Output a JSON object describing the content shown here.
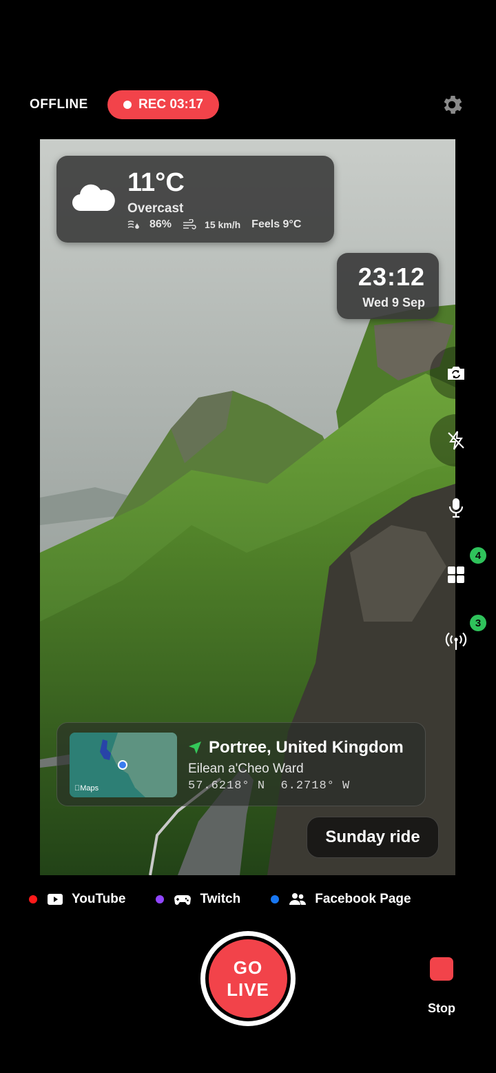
{
  "header": {
    "status": "OFFLINE",
    "recording_label": "REC 03:17",
    "settings_icon": "gear-icon"
  },
  "weather": {
    "temperature": "11°C",
    "condition": "Overcast",
    "humidity": "86%",
    "wind": "15 km/h",
    "feels_like": "Feels 9°C",
    "icon": "cloud-icon"
  },
  "clock": {
    "time": "23:12",
    "date": "Wed 9 Sep"
  },
  "location": {
    "place": "Portree, United Kingdom",
    "ward": "Eilean a'Cheo Ward",
    "latitude": "57.6218° N",
    "longitude": "6.2718° W",
    "map_label": "Maps"
  },
  "caption": "Sunday ride",
  "controls": {
    "overlays_badge": "4",
    "destinations_badge": "3"
  },
  "platforms": [
    {
      "name": "YouTube",
      "dot_color": "#ff1a1a",
      "icon": "youtube-icon"
    },
    {
      "name": "Twitch",
      "dot_color": "#9146ff",
      "icon": "gamepad-icon"
    },
    {
      "name": "Facebook Page",
      "dot_color": "#1877f2",
      "icon": "people-icon"
    }
  ],
  "bottom": {
    "golive_line1": "GO",
    "golive_line2": "LIVE",
    "stop_label": "Stop"
  },
  "colors": {
    "accent": "#f2434a",
    "badge": "#2fc25b"
  }
}
